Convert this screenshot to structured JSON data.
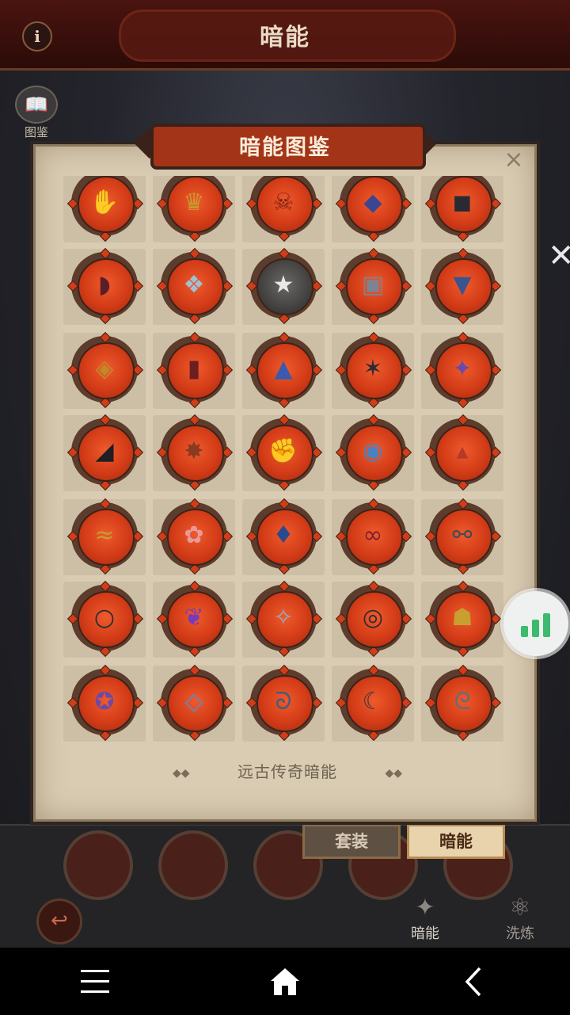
{
  "screen": {
    "title": "暗能"
  },
  "side": {
    "codex_label": "图鉴"
  },
  "modal": {
    "title": "暗能图鉴",
    "close_icon": "close-icon",
    "footer_label": "远古传奇暗能"
  },
  "tabs": [
    {
      "label": "套装",
      "active": false
    },
    {
      "label": "暗能",
      "active": true
    }
  ],
  "bottom_nav": [
    {
      "label": "暗能",
      "icon": "dark-energy-icon",
      "active": true
    },
    {
      "label": "洗炼",
      "icon": "refine-icon",
      "active": false
    }
  ],
  "grid": {
    "rows": [
      [
        "purple-glove-gem",
        "gold-spiked-helm-gem",
        "red-demon-mask-gem",
        "blue-dark-armor-gem",
        "black-armor-gem"
      ],
      [
        "crimson-belt-gem",
        "white-crystal-helm-gem",
        "grey-locked-star-gem",
        "steel-chest-gem",
        "blue-leg-guard-gem"
      ],
      [
        "gold-breastplate-gem",
        "red-trousers-gem",
        "blue-boots-gem",
        "spiked-skull-helm-gem",
        "purple-winged-helm-gem"
      ],
      [
        "black-shadow-boots-gem",
        "bronze-claw-gem",
        "brown-gauntlet-gem",
        "blue-demon-head-gem",
        "red-hood-gem"
      ],
      [
        "gold-crown-band-gem",
        "red-winged-circlet-gem",
        "blue-tabard-gem",
        "red-bow-tie-gem",
        "silver-chain-amulet-gem"
      ],
      [
        "dark-bracelet-gem",
        "purple-pendant-gem",
        "steel-wolf-helm-gem",
        "skull-eye-gem",
        "gold-mask-gem"
      ],
      [
        "purple-star-seal-gem",
        "blue-crystal-ring-gem",
        "serpent-ring-gem",
        "dark-hook-ring-gem",
        "twisted-ring-gem"
      ]
    ]
  },
  "colors": {
    "gem_red": "#d33c17",
    "parchment": "#d9ccb3",
    "accent_green": "#3cba6d"
  }
}
